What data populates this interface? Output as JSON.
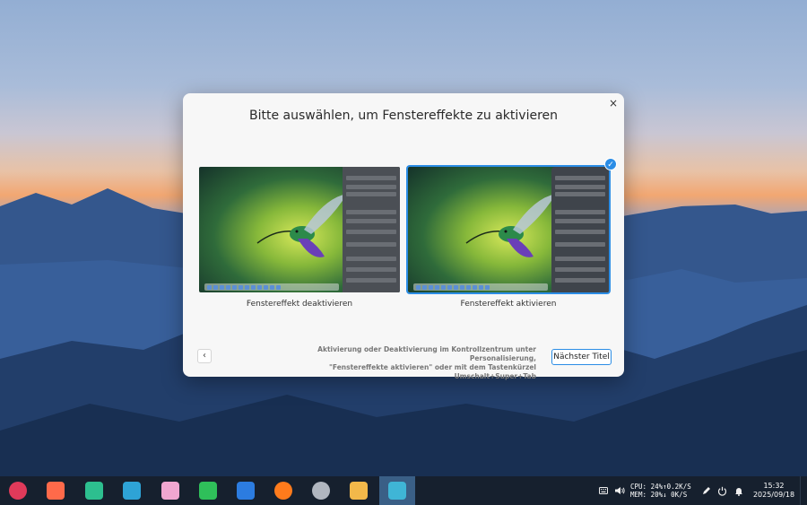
{
  "dialog": {
    "title": "Bitte auswählen, um Fenstereffekte zu aktivieren",
    "close_icon": "×",
    "options": [
      {
        "label": "Fenstereffekt deaktivieren",
        "selected": false
      },
      {
        "label": "Fenstereffekt aktivieren",
        "selected": true
      }
    ],
    "check_icon": "✓",
    "back_icon": "‹",
    "hint_line1": "Aktivierung oder Deaktivierung im Kontrollzentrum unter Personalisierung,",
    "hint_line2": "\"Fenstereffekte aktivieren\" oder mit dem Tastenkürzel Umschalt+Super+Tab",
    "next_button": "Nächster Titel"
  },
  "taskbar": {
    "apps": [
      {
        "name": "launcher-icon",
        "color": "#e03a5a"
      },
      {
        "name": "multitask-view-icon",
        "color": "#ff6a4a"
      },
      {
        "name": "file-manager-icon",
        "color": "#2dbf8f"
      },
      {
        "name": "app-store-icon",
        "color": "#2ea3d6"
      },
      {
        "name": "draw-icon",
        "color": "#f0a6d0"
      },
      {
        "name": "music-icon",
        "color": "#2fbf5a"
      },
      {
        "name": "movie-icon",
        "color": "#2c7ce0"
      },
      {
        "name": "firefox-icon",
        "color": "#ff7b1c"
      },
      {
        "name": "settings-icon",
        "color": "#b0b6c0"
      },
      {
        "name": "image-viewer-icon",
        "color": "#f2b84a"
      },
      {
        "name": "handshake-app-icon",
        "color": "#3fb5d6"
      }
    ],
    "cpu_line": "CPU: 24%↑0.2K/S",
    "mem_line": "MEM: 20%↓  0K/S",
    "time": "15:32",
    "date": "2025/09/18"
  }
}
